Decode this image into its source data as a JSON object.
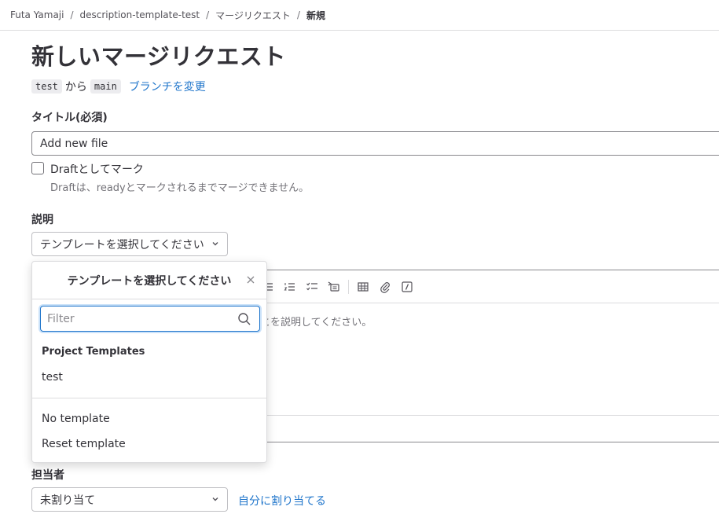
{
  "breadcrumb": {
    "items": [
      "Futa Yamaji",
      "description-template-test",
      "マージリクエスト",
      "新規"
    ],
    "separator": "/"
  },
  "page": {
    "title": "新しいマージリクエスト"
  },
  "branch": {
    "source": "test",
    "from_text": "から",
    "target": "main",
    "change_link": "ブランチを変更"
  },
  "form": {
    "title_label": "タイトル(必須)",
    "title_value": "Add new file",
    "draft_label": "Draftとしてマーク",
    "draft_help": "Draftは、readyとマークされるまでマージできません。",
    "description_label": "説明",
    "template_button": "テンプレートを選択してください",
    "editor_placeholder": "とを説明してください。",
    "assignee_label": "担当者",
    "assignee_value": "未割り当て",
    "assign_self_link": "自分に割り当てる"
  },
  "template_popover": {
    "title": "テンプレートを選択してください",
    "filter_placeholder": "Filter",
    "group_label": "Project Templates",
    "templates": [
      "test"
    ],
    "no_template": "No template",
    "reset_template": "Reset template"
  },
  "colors": {
    "link": "#1f75cb",
    "text": "#333238",
    "muted": "#737278",
    "border": "#dcdcde"
  }
}
